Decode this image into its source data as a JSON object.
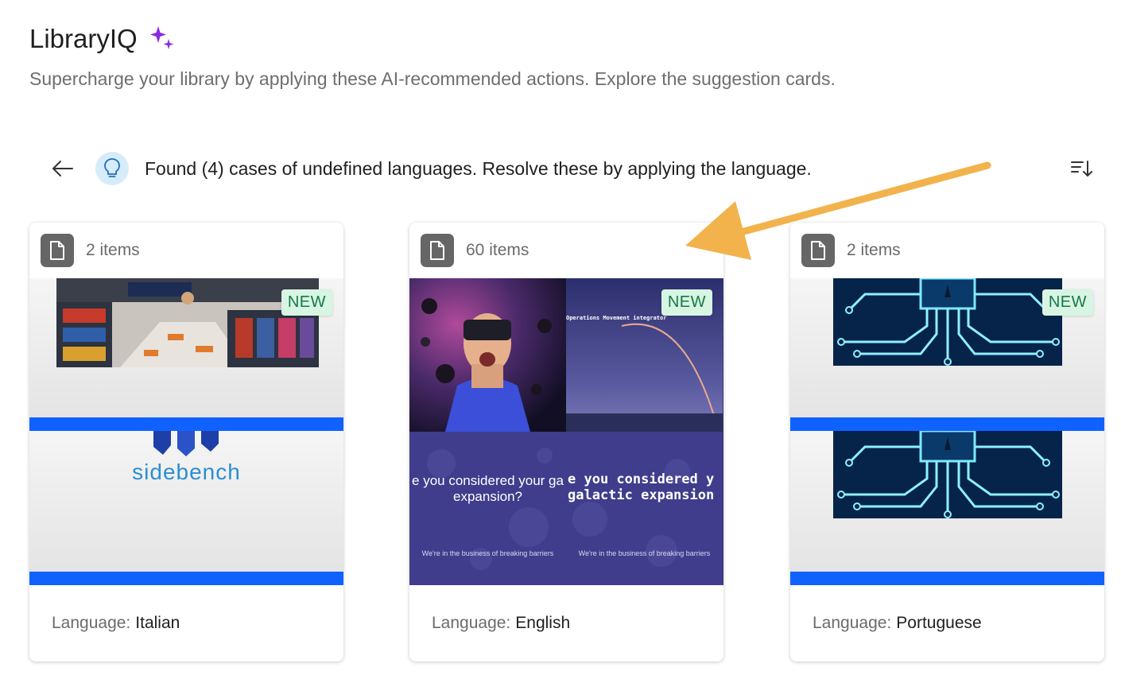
{
  "header": {
    "title": "LibraryIQ",
    "subtitle": "Supercharge your library by applying these AI-recommended actions. Explore the suggestion cards."
  },
  "suggestion": {
    "text": "Found (4) cases of undefined languages. Resolve these by applying the language."
  },
  "cards": [
    {
      "item_count": "2 items",
      "badge": "NEW",
      "language_label": "Language:",
      "language": "Italian",
      "preview_text": "sidebench"
    },
    {
      "item_count": "60 items",
      "badge": "NEW",
      "language_label": "Language:",
      "language": "English",
      "preview_caption_top": "Operations Movement integrator",
      "preview_text_left": "e you considered your ga",
      "preview_text_left_2": "expansion?",
      "preview_text_right": "e you considered y",
      "preview_text_right_2": "galactic expansion",
      "preview_footer_left": "We're in the business of breaking barriers",
      "preview_footer_right": "We're in the business of breaking barriers"
    },
    {
      "item_count": "2 items",
      "badge": "NEW",
      "language_label": "Language:",
      "language": "Portuguese"
    }
  ],
  "colors": {
    "accent_purple": "#8a2be2",
    "badge_bg": "#d7f5e2",
    "badge_text": "#17794a",
    "arrow": "#f2b24c",
    "band_blue": "#0f62fe"
  }
}
